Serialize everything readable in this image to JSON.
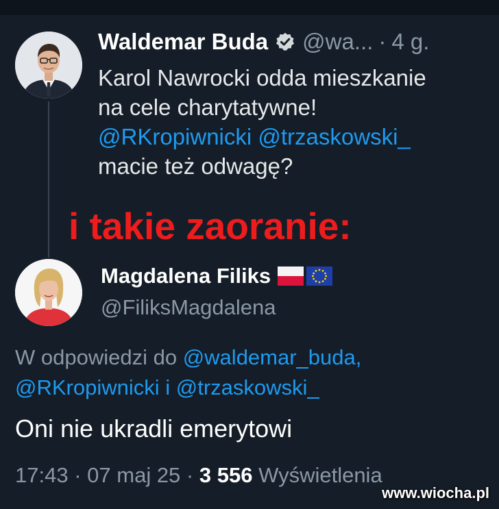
{
  "original_tweet": {
    "author_name": "Waldemar Buda",
    "handle": "@wa...",
    "separator": "·",
    "time": "4 g.",
    "lines": [
      "Karol Nawrocki odda mieszkanie",
      "na cele charytatywne!"
    ],
    "mention_1": "@RKropiwnicki",
    "mention_2": "@trzaskowski_",
    "last_line": "macie też odwagę?"
  },
  "overlay_caption": "i takie zaoranie:",
  "reply_tweet": {
    "author_name": "Magdalena Filiks",
    "handle": "@FiliksMagdalena",
    "reply_prefix": "W odpowiedzi do",
    "reply_mention_1": "@waldemar_buda,",
    "reply_mention_2": "@RKropiwnicki",
    "reply_conjunction": "i",
    "reply_mention_3": "@trzaskowski_",
    "text": "Oni nie ukradli emerytowi",
    "time": "17:43",
    "separator": "·",
    "date": "07 maj 25",
    "views_count": "3 556",
    "views_label": "Wyświetlenia"
  },
  "watermark": "www.wiocha.pl",
  "icons": {
    "verified": "verified-badge-icon",
    "flag_pl": "poland-flag-icon",
    "flag_eu": "eu-flag-icon"
  },
  "colors": {
    "background": "#151d28",
    "mention": "#1d9bf0",
    "secondary_text": "#8b98a5",
    "caption_red": "#ee1c1c"
  }
}
